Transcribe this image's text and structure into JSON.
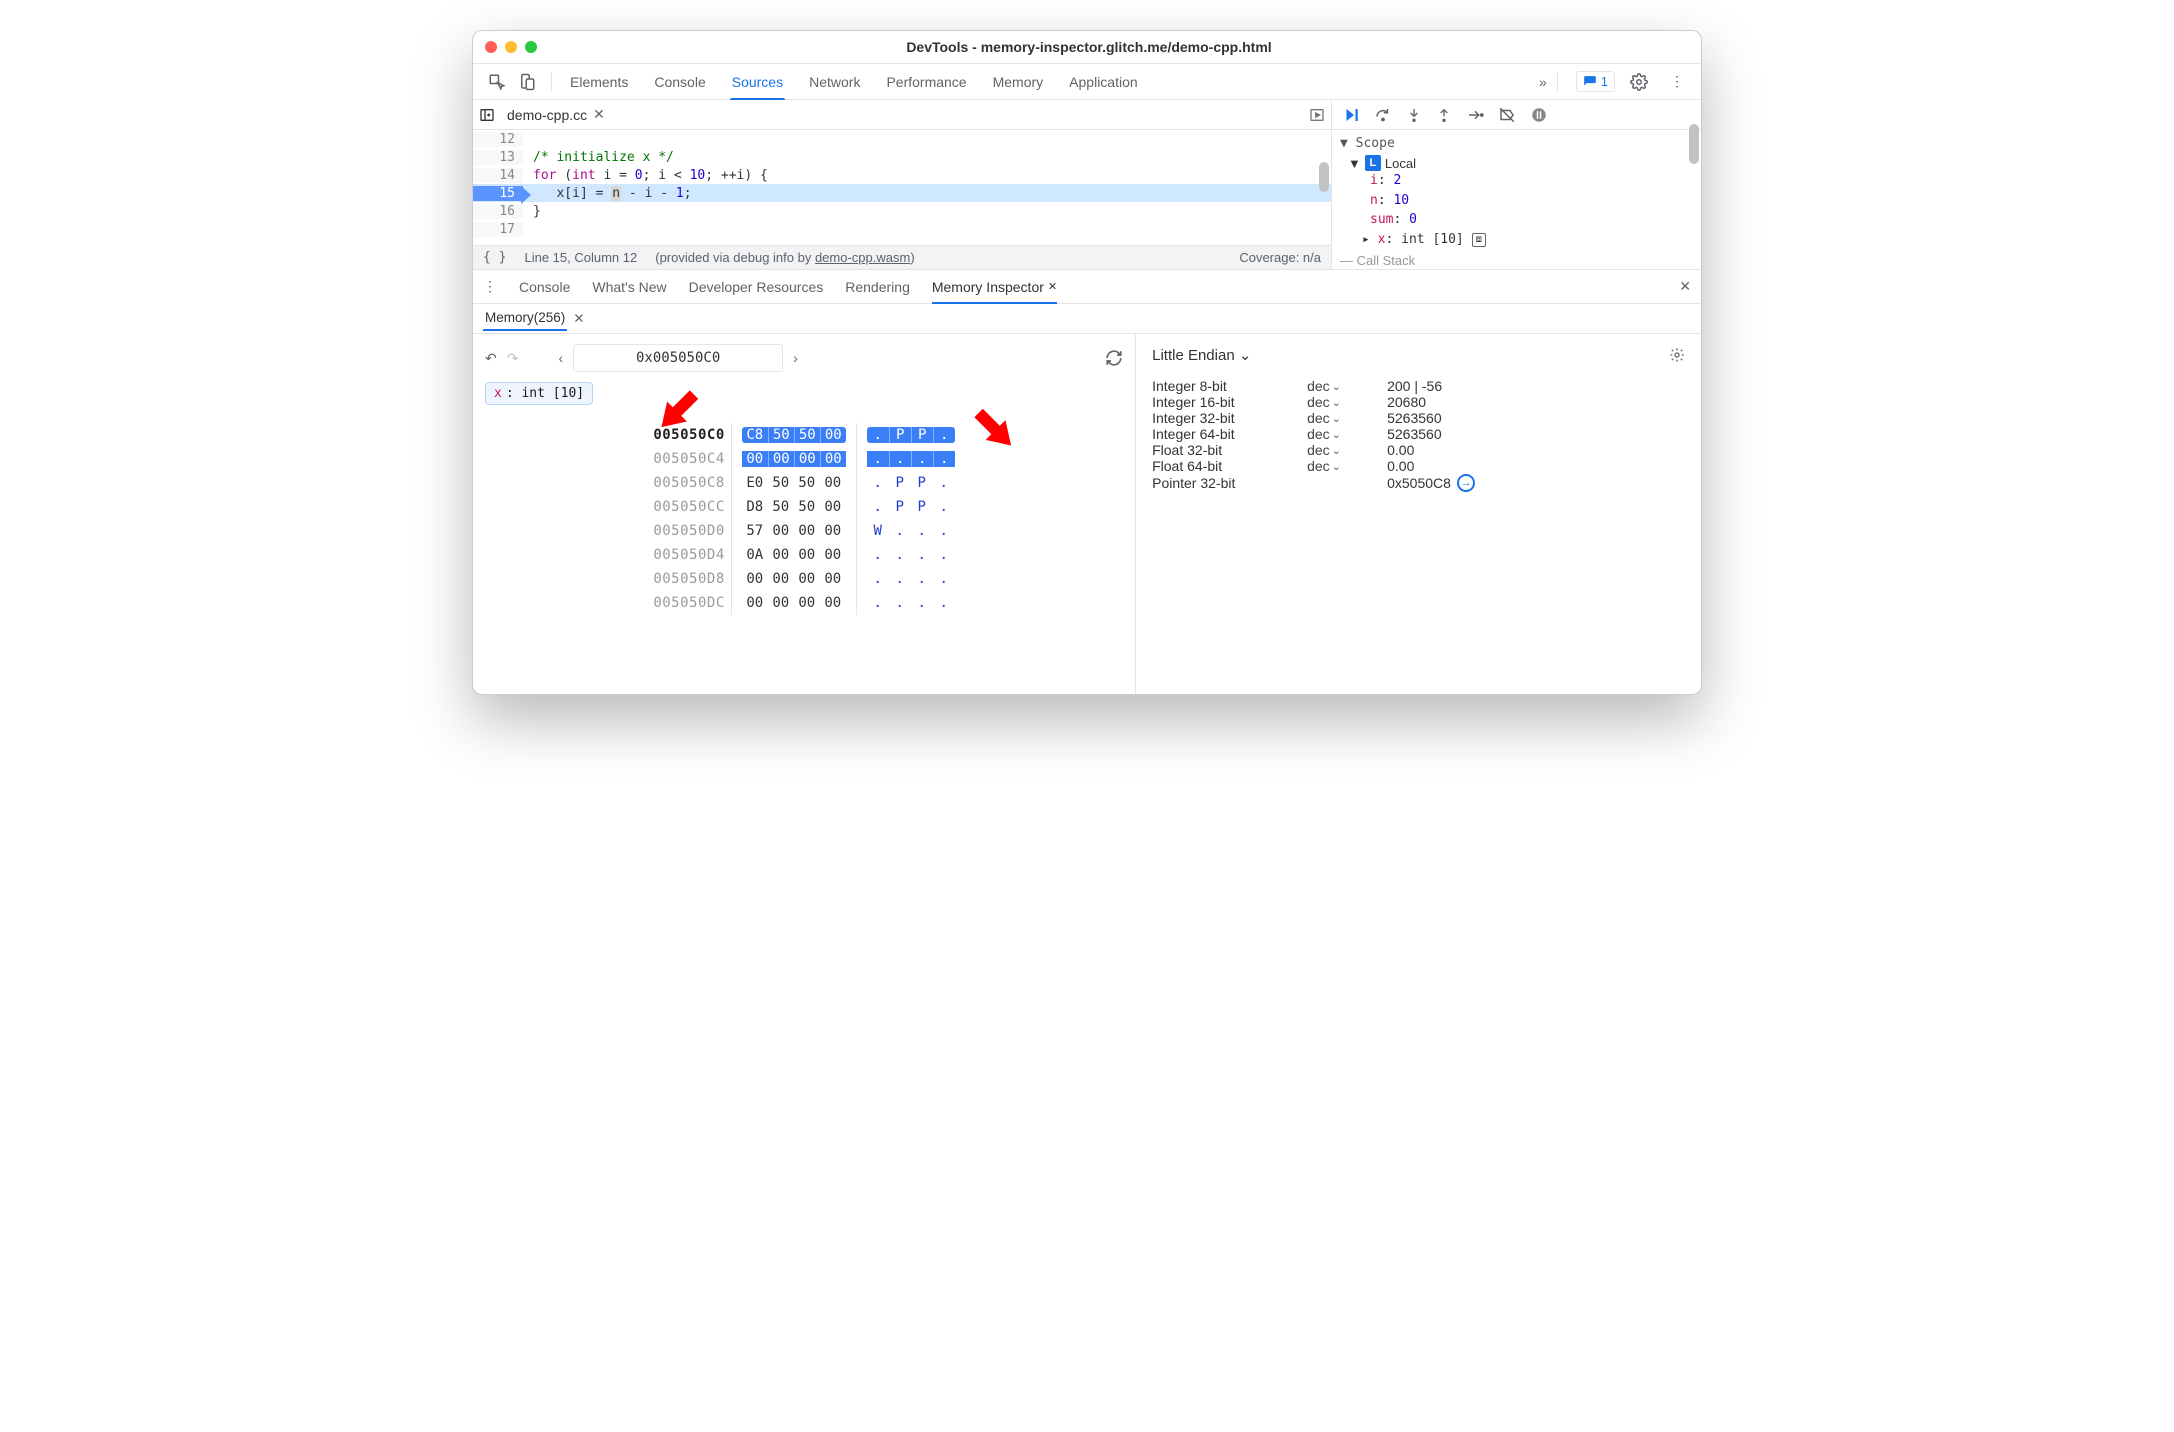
{
  "titlebar": {
    "title": "DevTools - memory-inspector.glitch.me/demo-cpp.html"
  },
  "main_tabs": {
    "items": [
      {
        "label": "Elements"
      },
      {
        "label": "Console"
      },
      {
        "label": "Sources",
        "active": true
      },
      {
        "label": "Network"
      },
      {
        "label": "Performance"
      },
      {
        "label": "Memory"
      },
      {
        "label": "Application"
      }
    ]
  },
  "errors_badge": "1",
  "sources": {
    "tab_label": "demo-cpp.cc",
    "lines": [
      {
        "n": 12,
        "html": ""
      },
      {
        "n": 13,
        "html": "<span class='cm'>/* initialize x */</span>"
      },
      {
        "n": 14,
        "html": "<span class='kw'>for</span> (<span class='kw'>int</span> i = <span class='num'>0</span>; i &lt; <span class='num'>10</span>; ++i) {"
      },
      {
        "n": 15,
        "html": "   x[i] = <span class='br-hl'>n</span> - i - <span class='num'>1</span>;",
        "current": true
      },
      {
        "n": 16,
        "html": "}"
      },
      {
        "n": 17,
        "html": ""
      }
    ],
    "status_pos": "Line 15, Column 12",
    "status_mid": "(provided via debug info by ",
    "status_link": "demo-cpp.wasm",
    "status_mid2": ")",
    "status_cov": "Coverage: n/a"
  },
  "scope": {
    "header_label": "Scope",
    "local_label": "Local",
    "rows": [
      {
        "name": "i",
        "value": "2"
      },
      {
        "name": "n",
        "value": "10"
      },
      {
        "name": "sum",
        "value": "0"
      }
    ],
    "x_label": "x",
    "x_value": "int [10]",
    "callstack_label": "Call Stack"
  },
  "drawer": {
    "menu_label": "⋮",
    "tabs": [
      {
        "label": "Console"
      },
      {
        "label": "What's New"
      },
      {
        "label": "Developer Resources"
      },
      {
        "label": "Rendering"
      },
      {
        "label": "Memory Inspector",
        "active": true,
        "closable": true
      }
    ],
    "sub_tab": "Memory(256)"
  },
  "memory_inspector": {
    "address": "0x005050C0",
    "object_chip_prefix": "x",
    "object_chip_suffix": ": int [10]",
    "rows": [
      {
        "addr": "005050C0",
        "bytes": [
          "C8",
          "50",
          "50",
          "00"
        ],
        "ascii": [
          ".",
          "P",
          "P",
          "."
        ],
        "hl": 1,
        "bold": true
      },
      {
        "addr": "005050C4",
        "bytes": [
          "00",
          "00",
          "00",
          "00"
        ],
        "ascii": [
          ".",
          ".",
          ".",
          "."
        ],
        "hl": 2
      },
      {
        "addr": "005050C8",
        "bytes": [
          "E0",
          "50",
          "50",
          "00"
        ],
        "ascii": [
          ".",
          "P",
          "P",
          "."
        ]
      },
      {
        "addr": "005050CC",
        "bytes": [
          "D8",
          "50",
          "50",
          "00"
        ],
        "ascii": [
          ".",
          "P",
          "P",
          "."
        ]
      },
      {
        "addr": "005050D0",
        "bytes": [
          "57",
          "00",
          "00",
          "00"
        ],
        "ascii": [
          "W",
          ".",
          ".",
          "."
        ]
      },
      {
        "addr": "005050D4",
        "bytes": [
          "0A",
          "00",
          "00",
          "00"
        ],
        "ascii": [
          ".",
          ".",
          ".",
          "."
        ]
      },
      {
        "addr": "005050D8",
        "bytes": [
          "00",
          "00",
          "00",
          "00"
        ],
        "ascii": [
          ".",
          ".",
          ".",
          "."
        ]
      },
      {
        "addr": "005050DC",
        "bytes": [
          "00",
          "00",
          "00",
          "00"
        ],
        "ascii": [
          ".",
          ".",
          ".",
          "."
        ]
      }
    ]
  },
  "value_panel": {
    "endian_label": "Little Endian",
    "rows": [
      {
        "label": "Integer 8-bit",
        "rep": "dec",
        "value": "200 | -56"
      },
      {
        "label": "Integer 16-bit",
        "rep": "dec",
        "value": "20680"
      },
      {
        "label": "Integer 32-bit",
        "rep": "dec",
        "value": "5263560"
      },
      {
        "label": "Integer 64-bit",
        "rep": "dec",
        "value": "5263560"
      },
      {
        "label": "Float 32-bit",
        "rep": "dec",
        "value": "0.00"
      },
      {
        "label": "Float 64-bit",
        "rep": "dec",
        "value": "0.00"
      },
      {
        "label": "Pointer 32-bit",
        "rep": "",
        "value": "0x5050C8",
        "pointer": true
      }
    ]
  }
}
